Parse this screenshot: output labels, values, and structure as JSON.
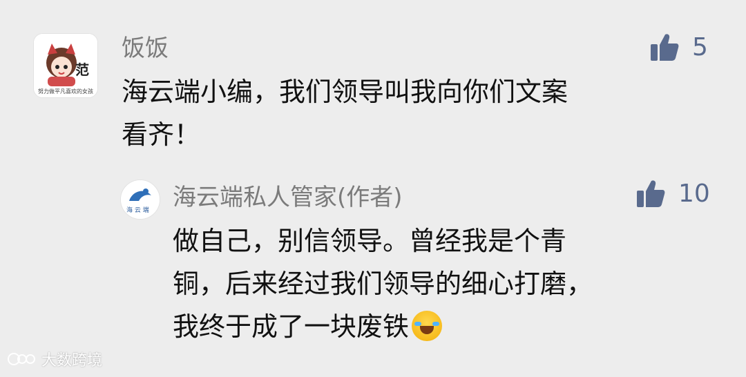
{
  "comment": {
    "author": "饭饭",
    "avatar_text": "范",
    "avatar_caption": "努力做平凡喜欢的女孩",
    "text_line1": "海云端小编，我们领导叫我向你们文案",
    "text_line2": "看齐！",
    "likes": "5"
  },
  "reply": {
    "author": "海云端私人管家(作者)",
    "avatar_caption": "海 云 端",
    "text_line1": "做自己，别信领导。曾经我是个青",
    "text_line2": "铜，后来经过我们领导的细心打磨，",
    "text_line3": "我终于成了一块废铁",
    "emoji": "laughing-crying-emoji",
    "likes": "10"
  },
  "watermark": {
    "text": "大数跨境"
  },
  "colors": {
    "background": "#ededed",
    "name": "#7b7b7b",
    "text": "#111111",
    "like": "#596a8d"
  }
}
